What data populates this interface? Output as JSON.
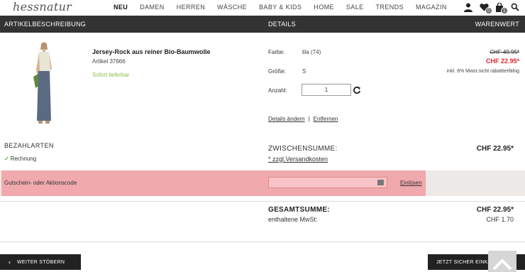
{
  "brand": {
    "logo_text": "hessnatur"
  },
  "nav": {
    "items": [
      {
        "label": "NEU",
        "active": true
      },
      {
        "label": "DAMEN"
      },
      {
        "label": "HERREN"
      },
      {
        "label": "WÄSCHE"
      },
      {
        "label": "BABY & KIDS"
      },
      {
        "label": "HOME"
      },
      {
        "label": "SALE"
      },
      {
        "label": "TRENDS"
      },
      {
        "label": "MAGAZIN"
      }
    ],
    "icons": [
      {
        "name": "user-icon"
      },
      {
        "name": "wishlist-heart-icon",
        "badge": "0"
      },
      {
        "name": "shopping-bag-icon",
        "badge": "1"
      },
      {
        "name": "search-icon"
      }
    ]
  },
  "table_header": {
    "col1": "ARTIKELBESCHREIBUNG",
    "col2": "DETAILS",
    "col3": "WARENWERT"
  },
  "product": {
    "title": "Jersey-Rock aus reiner Bio-Baumwolle",
    "article": "Artikel 37666",
    "availability": "Sofort lieferbar",
    "details": {
      "color_label": "Farbe:",
      "color_value": "lila (74)",
      "size_label": "Größe:",
      "size_value": "S",
      "qty_label": "Anzahl:",
      "qty_value": "1"
    },
    "links": {
      "edit": "Details ändern",
      "separator": "|",
      "remove": "Entfernen"
    },
    "price_old": "CHF 49.95*",
    "price_new": "CHF 22.95*",
    "vat_note": "inkl. 8% Mwst.nicht rabattierfähig"
  },
  "payment": {
    "title": "BEZAHLARTEN",
    "method": "Rechnung",
    "check_glyph": "✓"
  },
  "summary": {
    "subtotal_label": "ZWISCHENSUMME:",
    "shipping_link": "* zzgl.Versandkosten",
    "subtotal_value": "CHF 22.95*",
    "total_label": "GESAMTSUMME:",
    "total_value": "CHF 22.95*",
    "vat_label": "enthaltene MwSt:",
    "vat_value": "CHF 1.70"
  },
  "voucher": {
    "label": "Gutschein- oder Aktionscode",
    "input_value": "",
    "redeem_label": "Einlösen"
  },
  "buttons": {
    "back_label": "WEITER STÖBERN",
    "checkout_label": "JETZT SICHER EINKAUFEN"
  },
  "colors": {
    "header_bar": "#333333",
    "sale_price": "#e0262a",
    "in_stock": "#8cc04b",
    "voucher_highlight": "#f0a9ad"
  }
}
